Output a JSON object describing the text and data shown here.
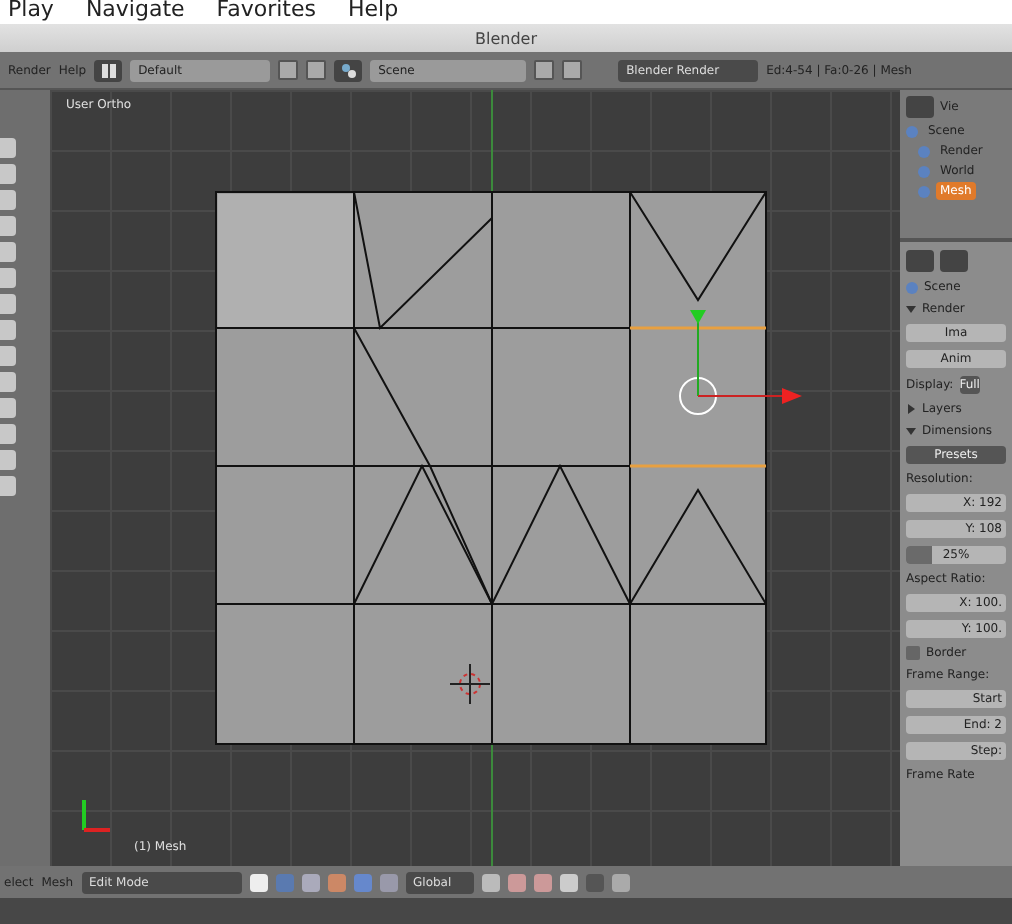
{
  "menu": [
    "Play",
    "Navigate",
    "Favorites",
    "Help"
  ],
  "window": {
    "title": "Blender"
  },
  "header": {
    "menus": [
      "Render",
      "Help"
    ],
    "layout": "Default",
    "scene": "Scene",
    "engine": "Blender Render",
    "stats": "Ed:4-54 | Fa:0-26 | Mesh"
  },
  "viewport": {
    "view_label": "User Ortho",
    "object_label": "(1) Mesh"
  },
  "outliner": {
    "view_menu": "Vie",
    "items": [
      {
        "label": "Scene",
        "selected": false,
        "children": [
          {
            "label": "Render",
            "selected": false
          },
          {
            "label": "World",
            "selected": false
          },
          {
            "label": "Mesh",
            "selected": true
          }
        ]
      }
    ]
  },
  "properties": {
    "context": "Scene",
    "sections": [
      {
        "title": "Render",
        "expanded": true,
        "kind": "render",
        "buttons": [
          "Ima",
          "Anim"
        ],
        "display_label": "Display:",
        "display_value": "Full"
      },
      {
        "title": "Layers",
        "expanded": false
      },
      {
        "title": "Dimensions",
        "expanded": true,
        "kind": "dimensions",
        "presets": "Presets",
        "resolution_label": "Resolution:",
        "res_x": "X: 192",
        "res_y": "Y: 108",
        "percent": {
          "text": "25%",
          "level": 0.25
        },
        "aspect_label": "Aspect Ratio:",
        "aspect_x": "X: 100.",
        "aspect_y": "Y: 100.",
        "border": {
          "label": "Border",
          "checked": false
        },
        "frame_label": "Frame Range:",
        "frames": [
          "Start",
          "End: 2",
          "Step:"
        ],
        "rate_label": "Frame Rate"
      }
    ]
  },
  "bottom_bar": {
    "menus": [
      "elect",
      "Mesh"
    ],
    "mode": "Edit Mode",
    "orientation": "Global"
  }
}
